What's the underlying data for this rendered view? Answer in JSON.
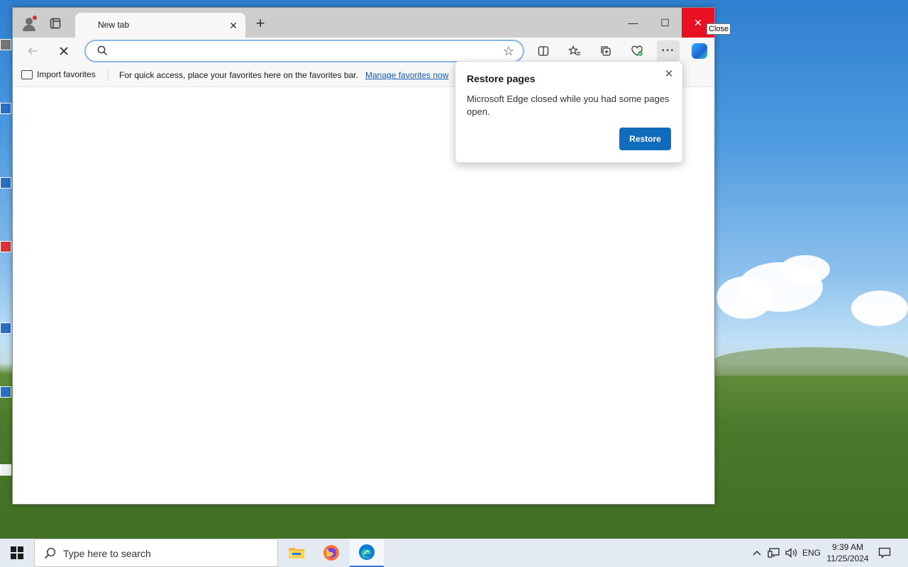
{
  "browser": {
    "tab": {
      "title": "New tab",
      "close_glyph": "✕"
    },
    "new_tab_glyph": "+",
    "window_controls": {
      "minimize": "—",
      "maximize": "☐",
      "close": "✕"
    },
    "close_tooltip": "Close",
    "address_bar": {
      "value": "",
      "placeholder": ""
    },
    "favorites_bar": {
      "import_label": "Import favorites",
      "message": "For quick access, place your favorites here on the favorites bar.",
      "manage_link": "Manage favorites now"
    },
    "restore_popup": {
      "title": "Restore pages",
      "body": "Microsoft Edge closed while you had some pages open.",
      "button": "Restore",
      "close_glyph": "✕"
    },
    "icons": {
      "profile": "profile-icon",
      "tab_actions": "tab-actions-icon",
      "back": "back-arrow-icon",
      "stop": "stop-icon",
      "search": "search-icon",
      "favorite": "star-icon",
      "split_screen": "split-screen-icon",
      "favorites": "favorites-icon",
      "collections": "collections-icon",
      "browser_essentials": "heart-icon",
      "more": "more-icon",
      "copilot": "copilot-icon"
    }
  },
  "taskbar": {
    "search_placeholder": "Type here to search",
    "language": "ENG",
    "time": "9:39 AM",
    "date": "11/25/2024",
    "apps": [
      "file-explorer",
      "firefox",
      "edge"
    ]
  },
  "colors": {
    "close_red": "#e81123",
    "restore_blue": "#0f6cbd",
    "link_blue": "#0f5ab7",
    "chrome_gray": "#cdcdcd",
    "toolbar_bg": "#f7f7f7"
  }
}
